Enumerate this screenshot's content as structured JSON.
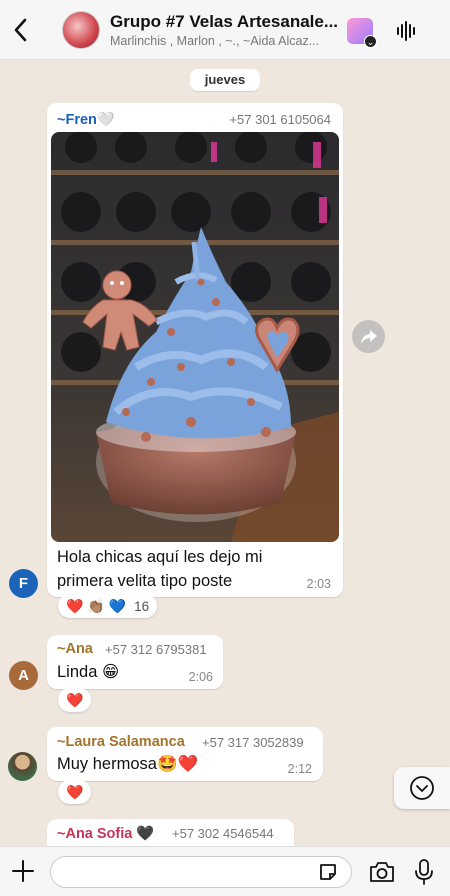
{
  "header": {
    "title": "Grupo #7 Velas Artesanale...",
    "subtitle": "Marlinchis , Marlon , ~., ~Aida Alcaz..."
  },
  "date_label": "jueves",
  "messages": [
    {
      "sender": "~Fren🤍",
      "phone": "+57 301 6105064",
      "text_line1": "Hola chicas aquí les dejo mi",
      "text_line2": "primera velita tipo poste",
      "time": "2:03",
      "avatar_letter": "F",
      "reactions": "❤️ 👏🏽 💙",
      "reaction_count": "16"
    },
    {
      "sender": "~Ana",
      "phone": "+57 312 6795381",
      "text": "Linda 😁",
      "time": "2:06",
      "avatar_letter": "A",
      "reactions": "❤️"
    },
    {
      "sender": "~Laura Salamanca",
      "phone": "+57 317 3052839",
      "text": "Muy hermosa🤩❤️",
      "time": "2:12",
      "reactions": "❤️"
    },
    {
      "sender": "~Ana Sofia 🖤",
      "phone": "+57 302 4546544"
    }
  ],
  "colors": {
    "fren_name": "#1a63b8",
    "ana_name": "#a3742b",
    "laura_name": "#a3742b",
    "sofia_name": "#c8355a",
    "avatar_f": "#1a63b8",
    "avatar_a": "#a86a3a"
  },
  "input": {
    "placeholder": ""
  },
  "icons": [
    "back-chevron-icon",
    "app-icon",
    "audio-wave-icon",
    "forward-icon",
    "chevron-down-icon",
    "plus-icon",
    "sticker-icon",
    "camera-icon",
    "mic-icon"
  ]
}
